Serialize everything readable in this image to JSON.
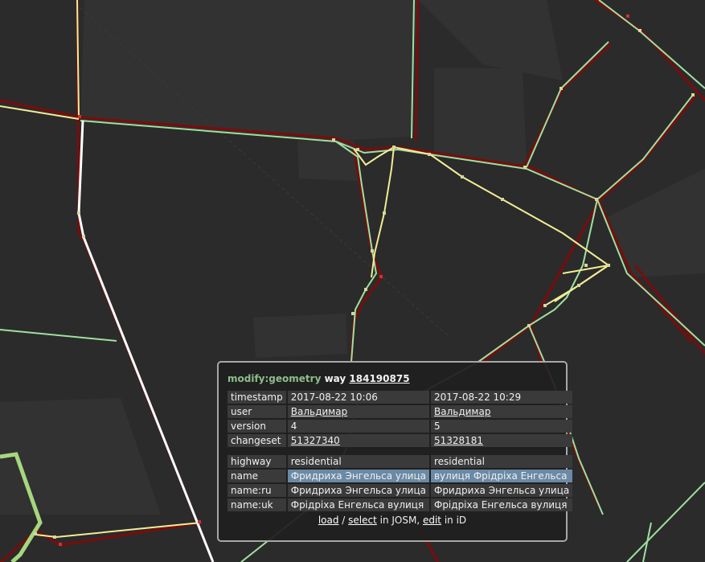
{
  "map": {
    "colors": {
      "background": "#2b2b2b",
      "block": "#333333",
      "old_way": "#7a0c0c",
      "new_way": "#9fe09f",
      "changed_way": "#f1ed96",
      "selected_way": "#ffffff",
      "thick_way": "#a6d77f",
      "node": "#d7d79a"
    }
  },
  "popup": {
    "action": "modify:geometry",
    "type": "way",
    "way_id": "184190875",
    "rows": [
      {
        "key": "timestamp",
        "old": "2017-08-22 10:06",
        "new": "2017-08-22 10:29",
        "link": false,
        "changed": false
      },
      {
        "key": "user",
        "old": "Вальдимар",
        "new": "Вальдимар",
        "link": true,
        "changed": false
      },
      {
        "key": "version",
        "old": "4",
        "new": "5",
        "link": false,
        "changed": false
      },
      {
        "key": "changeset",
        "old": "51327340",
        "new": "51328181",
        "link": true,
        "changed": false
      }
    ],
    "tags": [
      {
        "key": "highway",
        "old": "residential",
        "new": "residential",
        "changed": false
      },
      {
        "key": "name",
        "old": "Фридриха Энгельса улица",
        "new": "вулиця Фрідріха Енгельса",
        "changed": true
      },
      {
        "key": "name:ru",
        "old": "Фридриха Энгельса улица",
        "new": "Фридриха Энгельса улица",
        "changed": false
      },
      {
        "key": "name:uk",
        "old": "Фрідріха Енгельса вулиця",
        "new": "Фрідріха Енгельса вулиця",
        "changed": false
      }
    ],
    "footer": {
      "load": "load",
      "sep1": " / ",
      "select": "select",
      "in_josm": " in JOSM, ",
      "edit": "edit",
      "in_id": " in iD"
    }
  }
}
